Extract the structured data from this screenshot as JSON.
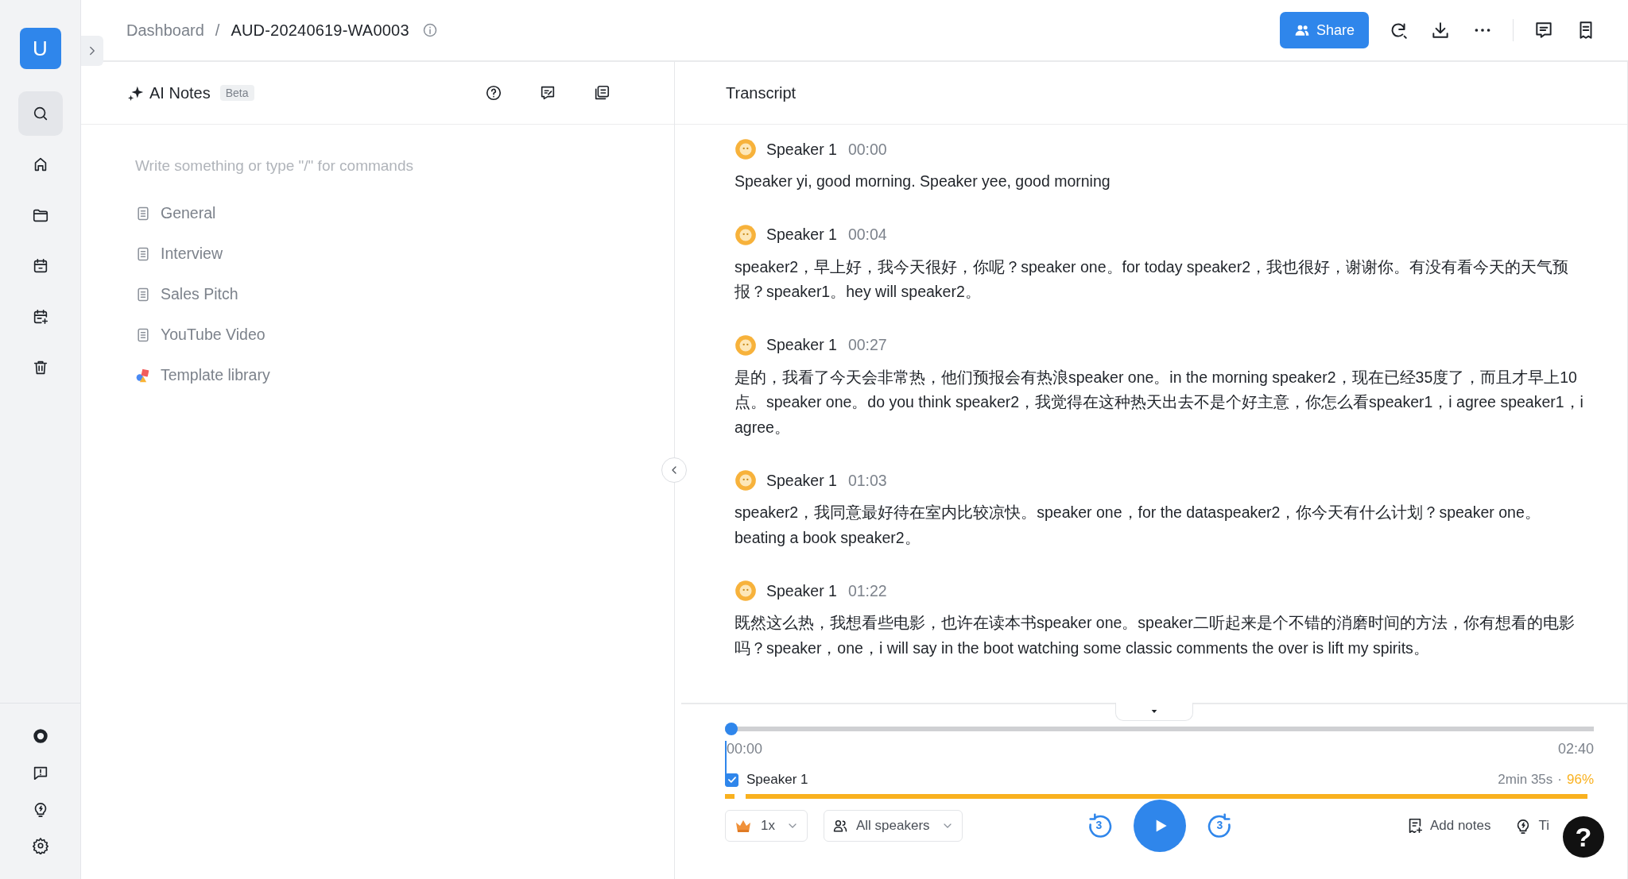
{
  "sidebar": {
    "avatar": "U"
  },
  "breadcrumb": {
    "parent": "Dashboard",
    "separator": "/",
    "current": "AUD-20240619-WA0003"
  },
  "share_button": "Share",
  "notes": {
    "title": "AI Notes",
    "badge": "Beta",
    "placeholder": "Write something or type \"/\" for commands",
    "templates": [
      {
        "label": "General",
        "kind": "doc"
      },
      {
        "label": "Interview",
        "kind": "doc"
      },
      {
        "label": "Sales Pitch",
        "kind": "doc"
      },
      {
        "label": "YouTube Video",
        "kind": "doc"
      },
      {
        "label": "Template library",
        "kind": "library"
      }
    ]
  },
  "transcript": {
    "title": "Transcript",
    "entries": [
      {
        "speaker": "Speaker 1",
        "time": "00:00",
        "text": "Speaker yi, good morning. Speaker yee, good morning"
      },
      {
        "speaker": "Speaker 1",
        "time": "00:04",
        "text": "speaker2，早上好，我今天很好，你呢？speaker one。for today speaker2，我也很好，谢谢你。有没有看今天的天气预报？speaker1。hey will speaker2。"
      },
      {
        "speaker": "Speaker 1",
        "time": "00:27",
        "text": "是的，我看了今天会非常热，他们预报会有热浪speaker one。in the morning speaker2，现在已经35度了，而且才早上10点。speaker one。do you think speaker2，我觉得在这种热天出去不是个好主意，你怎么看speaker1，i agree speaker1，i agree。"
      },
      {
        "speaker": "Speaker 1",
        "time": "01:03",
        "text": "speaker2，我同意最好待在室内比较凉快。speaker one，for the dataspeaker2，你今天有什么计划？speaker one。beating a book speaker2。"
      },
      {
        "speaker": "Speaker 1",
        "time": "01:22",
        "text": "既然这么热，我想看些电影，也许在读本书speaker one。speaker二听起来是个不错的消磨时间的方法，你有想看的电影吗？speaker，one，i will say in the boot watching some classic comments the over is lift my spirits。"
      }
    ]
  },
  "player": {
    "level": 0,
    "start": "00:00",
    "end": "02:40",
    "speakers": [
      {
        "name": "Speaker 1",
        "checked": true,
        "duration": "2min 35s",
        "separator": "·",
        "share": "96%"
      }
    ],
    "speed": "1x",
    "speaker_filter": "All speakers",
    "rewind": "3",
    "forward": "3",
    "add_notes": "Add notes",
    "tips": "Ti",
    "help": "?"
  }
}
